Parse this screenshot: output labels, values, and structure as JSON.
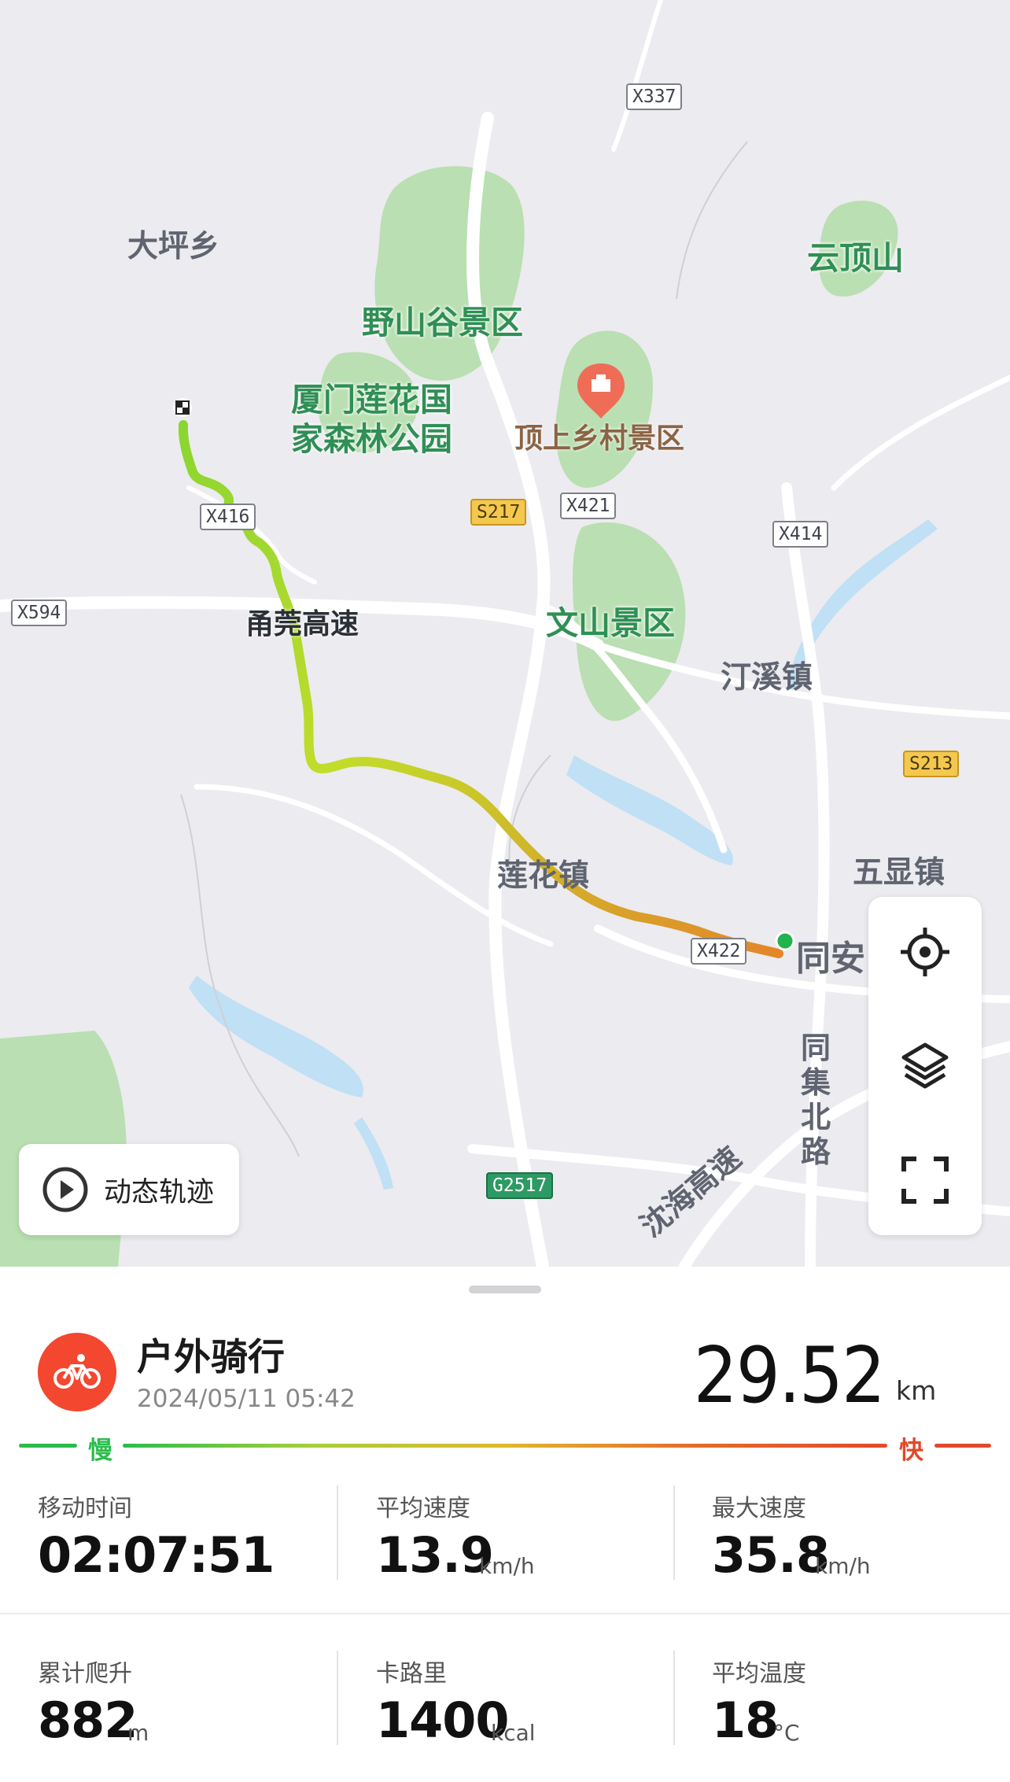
{
  "map": {
    "labels": {
      "dapingxiang": "大坪乡",
      "yunding": "云顶山",
      "yeshangu": "野山谷景区",
      "lianhua_line1": "厦门莲花国",
      "lianhua_line2": "家森林公园",
      "dingshang": "顶上乡村景区",
      "wenshan": "文山景区",
      "tingxi": "汀溪镇",
      "yongguan": "甬莞高速",
      "lianhuazhen": "莲花镇",
      "wuxian": "五显镇",
      "tongan": "同安",
      "tongji_road": "同集北路",
      "haiwei": "沈海高速"
    },
    "road_tags": {
      "x337": "X337",
      "x421": "X421",
      "x414": "X414",
      "x594": "X594",
      "x416": "X416",
      "x422": "X422",
      "s217": "S217",
      "s213": "S213",
      "g2517": "G2517"
    }
  },
  "controls": {
    "locate_icon": "crosshair-icon",
    "layers_icon": "layers-icon",
    "fullscreen_icon": "fullscreen-icon"
  },
  "replay": {
    "label": "动态轨迹",
    "icon": "play-circle-icon"
  },
  "activity": {
    "type": "户外骑行",
    "datetime": "2024/05/11 05:42",
    "icon": "bicycle-icon",
    "icon_color": "#f3472f",
    "distance": "29.52",
    "distance_unit": "km"
  },
  "speed_legend": {
    "slow": "慢",
    "fast": "快",
    "slow_color": "#2bbc4d",
    "fast_color": "#e04a2c"
  },
  "stats": [
    {
      "label": "移动时间",
      "value": "02:07:51",
      "unit": ""
    },
    {
      "label": "平均速度",
      "value": "13.9",
      "unit": "km/h"
    },
    {
      "label": "最大速度",
      "value": "35.8",
      "unit": "km/h"
    },
    {
      "label": "累计爬升",
      "value": "882",
      "unit": "m"
    },
    {
      "label": "卡路里",
      "value": "1400",
      "unit": "kcal"
    },
    {
      "label": "平均温度",
      "value": "18",
      "unit": "°C"
    }
  ]
}
